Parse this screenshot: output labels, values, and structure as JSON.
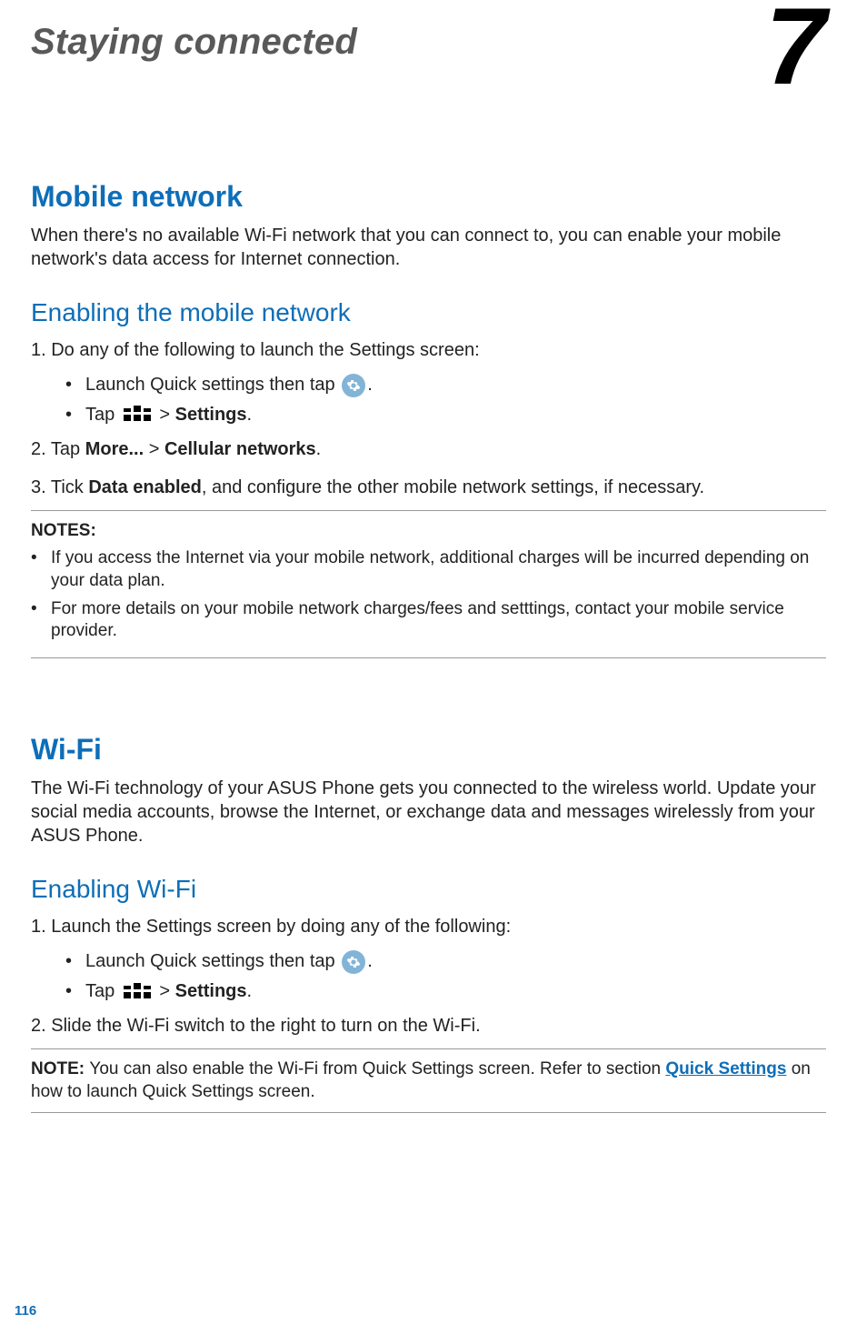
{
  "chapter": {
    "title": "Staying connected",
    "number": "7"
  },
  "mobile": {
    "heading": "Mobile network",
    "intro": "When there's no available Wi-Fi network that you can connect to, you can enable your mobile network's data access for Internet connection.",
    "sub": "Enabling the mobile network",
    "step1": "1.  Do any of the following to launch the Settings screen:",
    "b1_pre": "Launch Quick settings then tap ",
    "b1_post": ".",
    "b2_pre": "Tap ",
    "b2_mid": " > ",
    "b2_bold": "Settings",
    "b2_post": ".",
    "step2_pre": "2.  Tap ",
    "step2_b1": "More...",
    "step2_mid": " > ",
    "step2_b2": "Cellular networks",
    "step2_post": ".",
    "step3_pre": "3.  Tick ",
    "step3_b": "Data enabled",
    "step3_post": ", and configure the other mobile network settings, if necessary.",
    "notes_label": "NOTES:",
    "note1": "If you access the Internet via your mobile network, additional charges will be incurred depending on your data plan.",
    "note2": "For more details on your mobile network charges/fees and setttings, contact your mobile service provider."
  },
  "wifi": {
    "heading": "Wi-Fi",
    "intro": "The Wi-Fi technology of your ASUS Phone gets you connected to the wireless world. Update your social media accounts, browse the Internet, or exchange data and messages wirelessly from your ASUS Phone.",
    "sub": "Enabling Wi-Fi",
    "step1": "1.  Launch the Settings screen by doing any of the following:",
    "b1_pre": "Launch Quick settings then tap ",
    "b1_post": ".",
    "b2_pre": "Tap ",
    "b2_mid": " > ",
    "b2_bold": "Settings",
    "b2_post": ".",
    "step2": "2.  Slide the Wi-Fi switch to the right to turn on the Wi-Fi.",
    "note_label": "NOTE:  ",
    "note_pre": "You can also enable the Wi-Fi from Quick Settings screen. Refer to section ",
    "note_link": "Quick Settings",
    "note_post": " on how to launch Quick Settings screen."
  },
  "page_number": "116"
}
